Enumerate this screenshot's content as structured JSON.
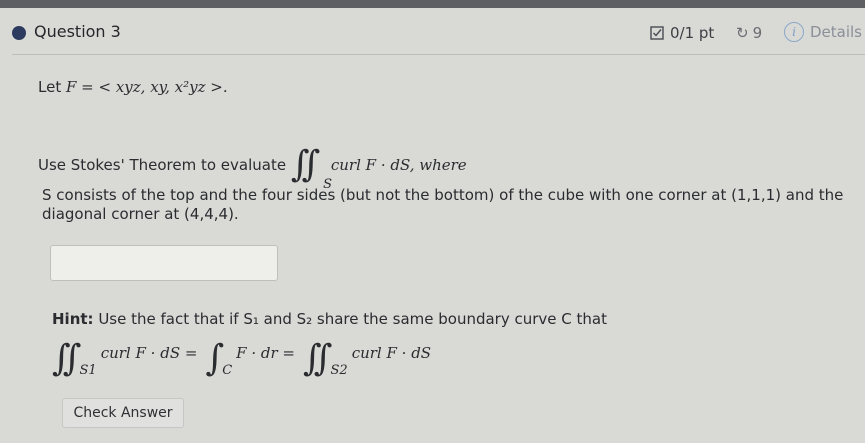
{
  "header": {
    "question_title": "Question 3",
    "score": "0/1 pt",
    "retries": "9",
    "details": "Details"
  },
  "problem": {
    "let_prefix": "Let",
    "field_def": "F = < xyz, xy, x²yz >.",
    "prompt": "Use Stokes' Theorem to evaluate",
    "integrand": "curl F · dS, where",
    "surface_sub": "S",
    "surface_desc": "S consists of the top and the four sides (but not the bottom) of the cube with one corner at (1,1,1) and the diagonal corner at (4,4,4)."
  },
  "answer": {
    "value": ""
  },
  "hint": {
    "label": "Hint:",
    "text": "Use the fact that if S₁ and S₂ share the same boundary curve C that",
    "eq_left": "curl F · dS =",
    "eq_left_sub": "S1",
    "eq_mid": "F · dr =",
    "eq_mid_sub": "C",
    "eq_right": "curl F · dS",
    "eq_right_sub": "S2"
  },
  "buttons": {
    "check_answer": "Check Answer"
  }
}
